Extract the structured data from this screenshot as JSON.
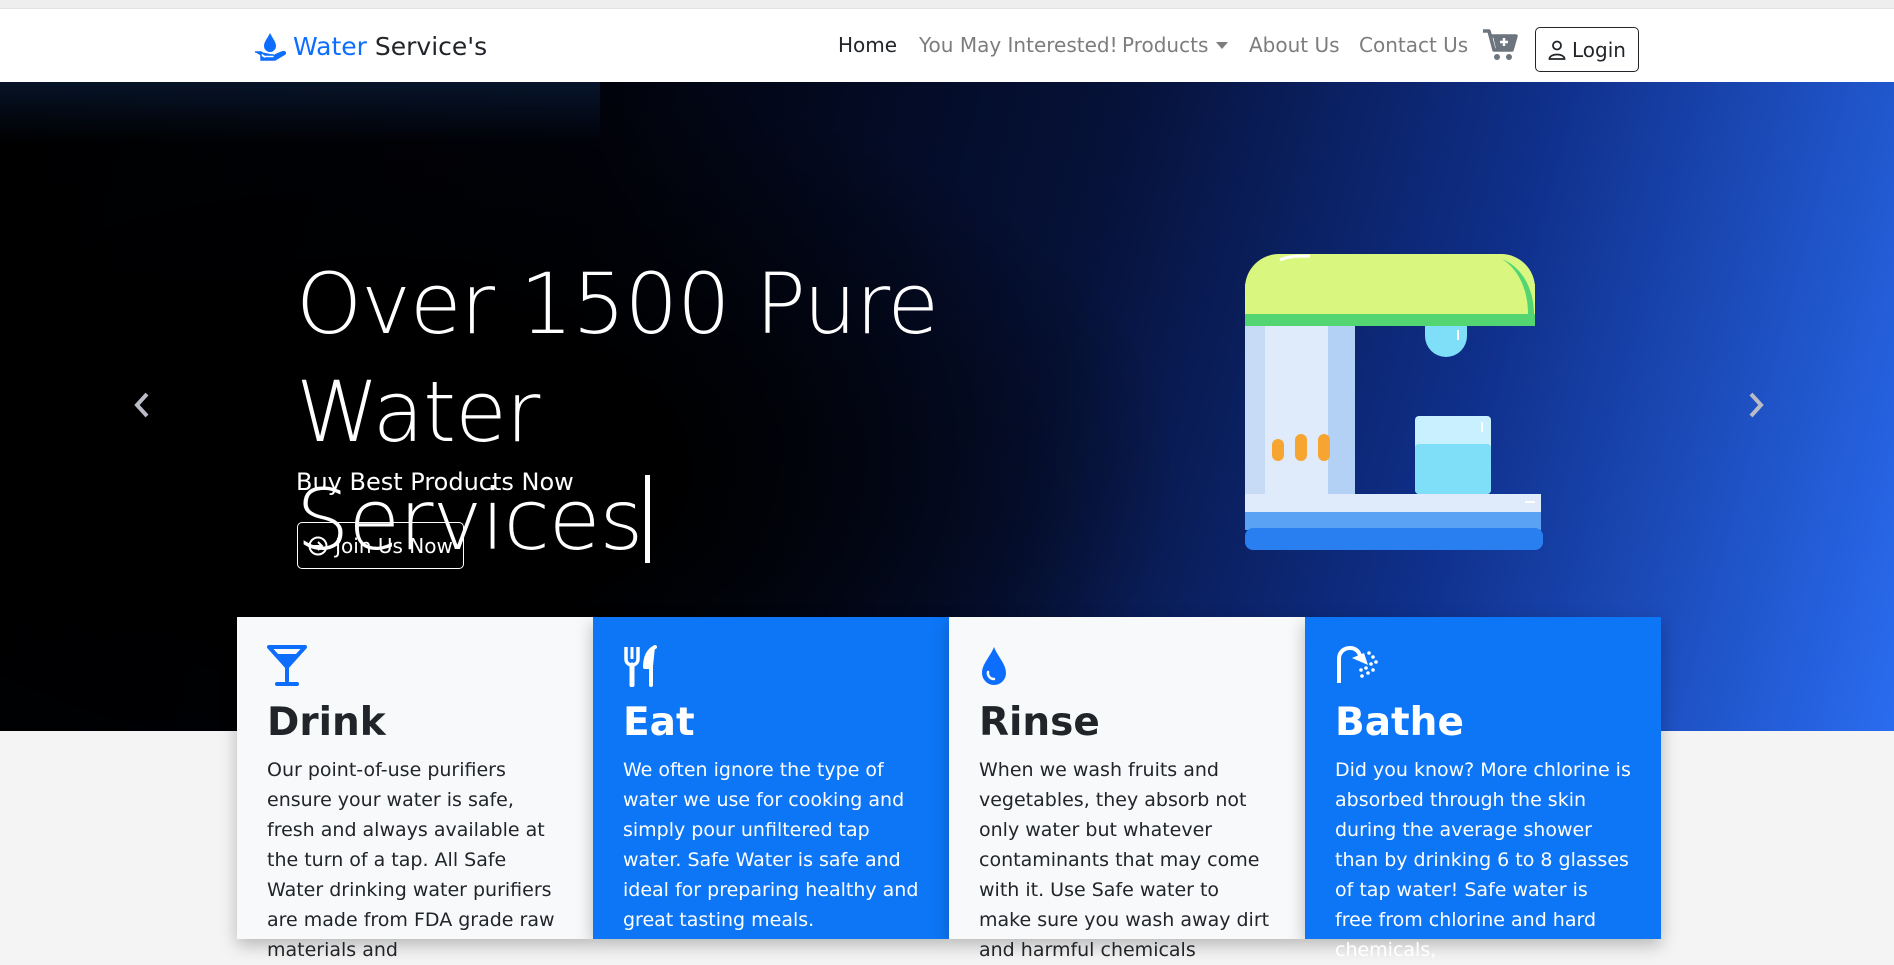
{
  "brand": {
    "part1": "Water",
    "part2": "Service's"
  },
  "nav": {
    "home": "Home",
    "interested": "You May Interested!",
    "products": "Products",
    "about": "About Us",
    "contact": "Contact Us",
    "login": "Login"
  },
  "hero": {
    "title_line1": "Over 1500 Pure Water",
    "title_line2": "Services",
    "subtitle": "Buy Best Products Now",
    "button": "Join Us Now"
  },
  "cards": [
    {
      "title": "Drink",
      "icon": "cocktail-glass-icon",
      "text": "Our point-of-use purifiers ensure your water is safe, fresh and always available at the turn of a tap. All Safe Water drinking water purifiers are made from FDA grade raw materials and"
    },
    {
      "title": "Eat",
      "icon": "utensils-icon",
      "text": "We often ignore the type of water we use for cooking and simply pour unfiltered tap water. Safe Water is safe and ideal for preparing healthy and great tasting meals."
    },
    {
      "title": "Rinse",
      "icon": "water-drop-icon",
      "text": "When we wash fruits and vegetables, they absorb not only water but whatever contaminants that may come with it. Use Safe water to make sure you wash away dirt and harmful chemicals"
    },
    {
      "title": "Bathe",
      "icon": "shower-icon",
      "text": "Did you know? More chlorine is absorbed through the skin during the average shower than by drinking 6 to 8 glasses of tap water! Safe water is free from chlorine and hard chemicals,"
    }
  ],
  "colors": {
    "primary": "#0d6efd",
    "card_blue": "#0d76f7",
    "dark": "#212529"
  }
}
